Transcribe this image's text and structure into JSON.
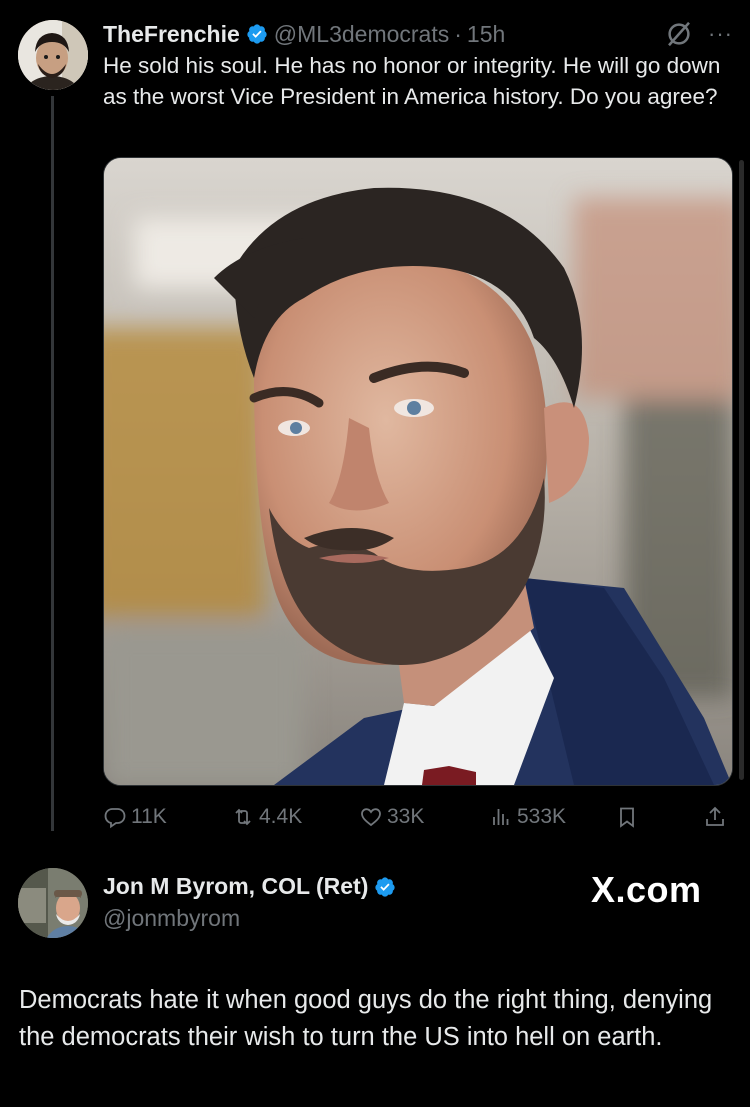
{
  "tweet1": {
    "display_name": "TheFrenchie",
    "handle": "@ML3democrats",
    "separator": "·",
    "time": "15h",
    "more": "···",
    "text": "He sold his soul. He has no honor or integrity. He will go down as the worst Vice President in America history. Do you agree?",
    "media_icon": "photo-man-in-suit",
    "actions": {
      "replies": "11K",
      "retweets": "4.4K",
      "likes": "33K",
      "views": "533K"
    }
  },
  "tweet2": {
    "display_name": "Jon M Byrom, COL (Ret)",
    "handle": "@jonmbyrom",
    "text": "Democrats hate it when good guys do the right thing, denying the democrats their wish to turn the US into hell on earth."
  },
  "watermark": "X.com",
  "colors": {
    "background": "#000000",
    "text": "#e7e9ea",
    "secondary": "#71767b",
    "verified": "#1d9bf0",
    "thread_line": "#333639"
  },
  "icons": [
    "verified-badge-icon",
    "grok-icon",
    "more-icon",
    "reply-icon",
    "retweet-icon",
    "like-icon",
    "views-icon",
    "bookmark-icon",
    "share-icon"
  ]
}
